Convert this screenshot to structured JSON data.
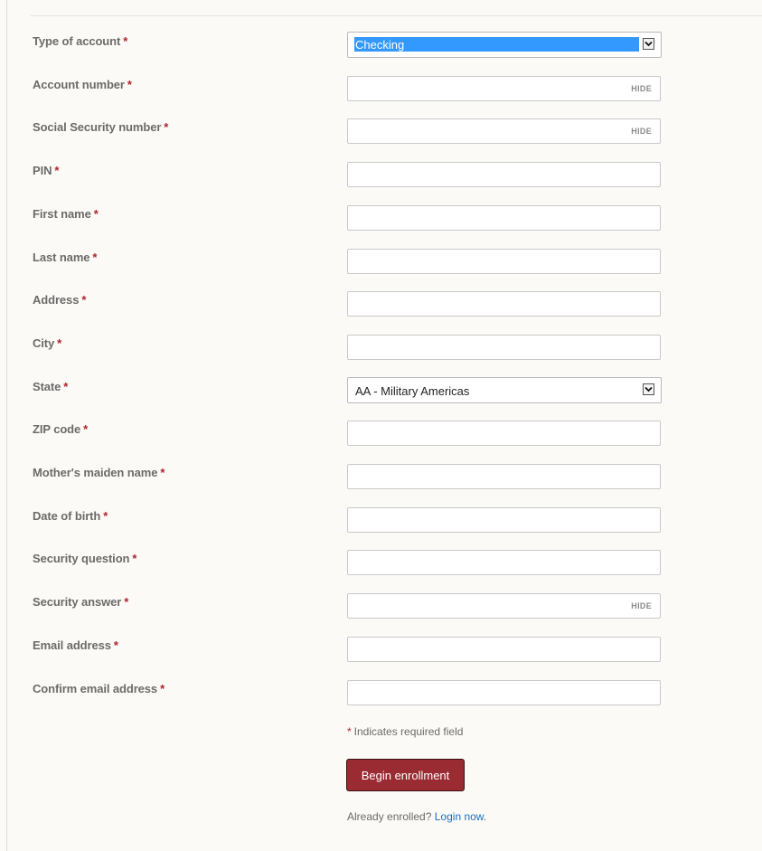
{
  "form": {
    "fields": [
      {
        "label": "Type of account",
        "required_mark": "*",
        "type": "select",
        "value": "Checking",
        "highlighted": true
      },
      {
        "label": "Account number",
        "required_mark": "*",
        "type": "masked",
        "value": "",
        "toggle_label": "HIDE"
      },
      {
        "label": "Social Security number",
        "required_mark": "*",
        "type": "masked",
        "value": "",
        "toggle_label": "HIDE"
      },
      {
        "label": "PIN",
        "required_mark": "*",
        "type": "text",
        "value": ""
      },
      {
        "label": "First name",
        "required_mark": "*",
        "type": "text",
        "value": ""
      },
      {
        "label": "Last name",
        "required_mark": "*",
        "type": "text",
        "value": ""
      },
      {
        "label": "Address",
        "required_mark": "*",
        "type": "text",
        "value": ""
      },
      {
        "label": "City",
        "required_mark": "*",
        "type": "text",
        "value": ""
      },
      {
        "label": "State",
        "required_mark": "*",
        "type": "select",
        "value": "AA - Military Americas",
        "highlighted": false
      },
      {
        "label": "ZIP code",
        "required_mark": "*",
        "type": "text",
        "value": ""
      },
      {
        "label": "Mother's maiden name",
        "required_mark": "*",
        "type": "text",
        "value": ""
      },
      {
        "label": "Date of birth",
        "required_mark": "*",
        "type": "text",
        "value": ""
      },
      {
        "label": "Security question",
        "required_mark": "*",
        "type": "text",
        "value": ""
      },
      {
        "label": "Security answer",
        "required_mark": "*",
        "type": "masked",
        "value": "",
        "toggle_label": "HIDE"
      },
      {
        "label": "Email address",
        "required_mark": "*",
        "type": "text",
        "value": ""
      },
      {
        "label": "Confirm email address",
        "required_mark": "*",
        "type": "text",
        "value": ""
      }
    ],
    "required_note": {
      "mark": "*",
      "text": "Indicates required field"
    },
    "submit_label": "Begin enrollment",
    "already_enrolled": {
      "text": "Already enrolled?",
      "link": "Login now",
      "trailing": "."
    }
  },
  "colors": {
    "required": "#b1232f",
    "button_bg": "#9a2b33",
    "link": "#1a6fc4",
    "select_highlight": "#3399ff"
  }
}
